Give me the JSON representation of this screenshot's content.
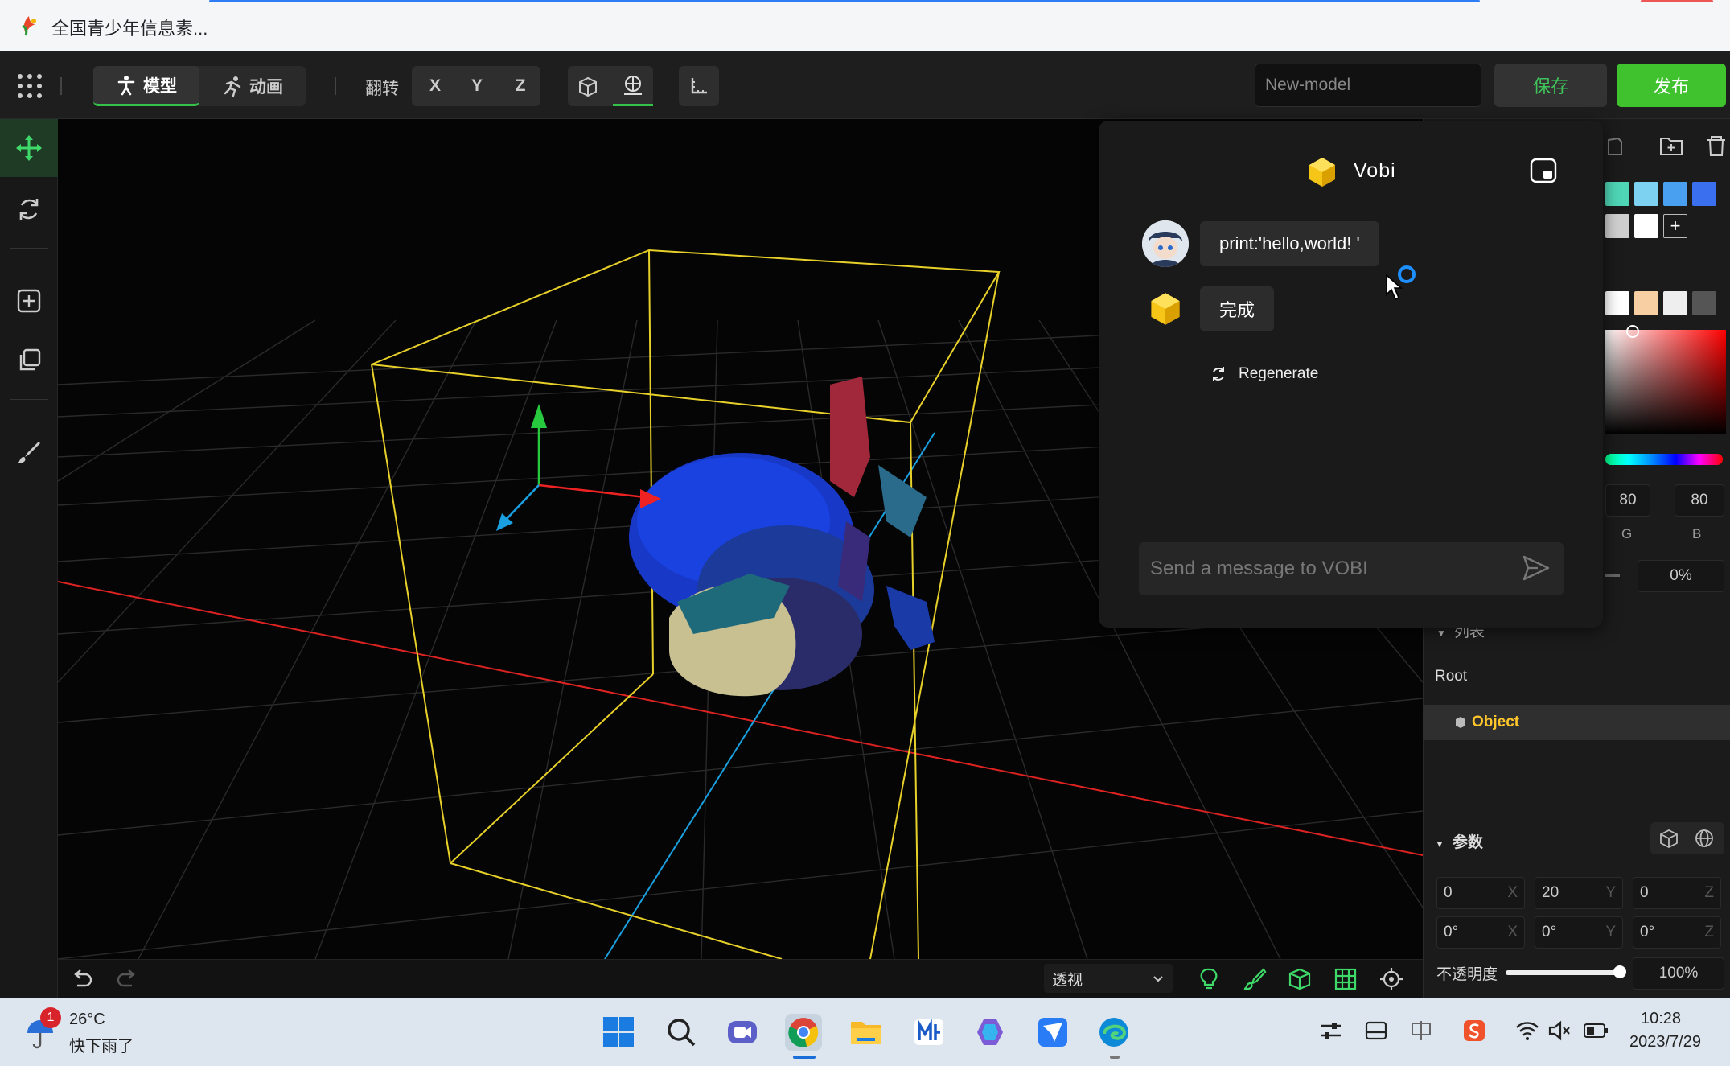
{
  "browser": {
    "tab_title": "全国青少年信息素..."
  },
  "toolbar": {
    "mode_model": "模型",
    "mode_animation": "动画",
    "flip_label": "翻转",
    "axis_x": "X",
    "axis_y": "Y",
    "axis_z": "Z",
    "model_name": "New-model",
    "save": "保存",
    "publish": "发布"
  },
  "chat": {
    "title": "Vobi",
    "user_message": "print:'hello,world! '",
    "bot_reply": "完成",
    "regenerate": "Regenerate",
    "input_placeholder": "Send a message to VOBI"
  },
  "color_panel": {
    "swatches_row1": [
      "#4fd6b6",
      "#7cd2f0",
      "#4aa0f0",
      "#3a6ff0"
    ],
    "swatches_row2": [
      "#cfcfcf",
      "#ffffff"
    ],
    "swatches_row3": [
      "#ffffff",
      "#f8cfa3",
      "#eeeeee",
      "#555555"
    ],
    "g_value": "80",
    "b_value": "80",
    "g_label": "G",
    "b_label": "B",
    "opacity_value": "0%"
  },
  "outline": {
    "list_header": "列表",
    "root": "Root",
    "object": "Object"
  },
  "params": {
    "header": "参数",
    "position": [
      "0",
      "20",
      "0"
    ],
    "rotation": [
      "0°",
      "0°",
      "0°"
    ],
    "axis_labels": [
      "X",
      "Y",
      "Z"
    ],
    "opacity_label": "不透明度",
    "opacity_value": "100%",
    "opacity_fraction": 1.0
  },
  "viewport": {
    "view_mode": "透视"
  },
  "taskbar": {
    "weather_temp": "26°C",
    "weather_desc": "快下雨了",
    "notification_count": "1",
    "time": "10:28",
    "date": "2023/7/29"
  }
}
